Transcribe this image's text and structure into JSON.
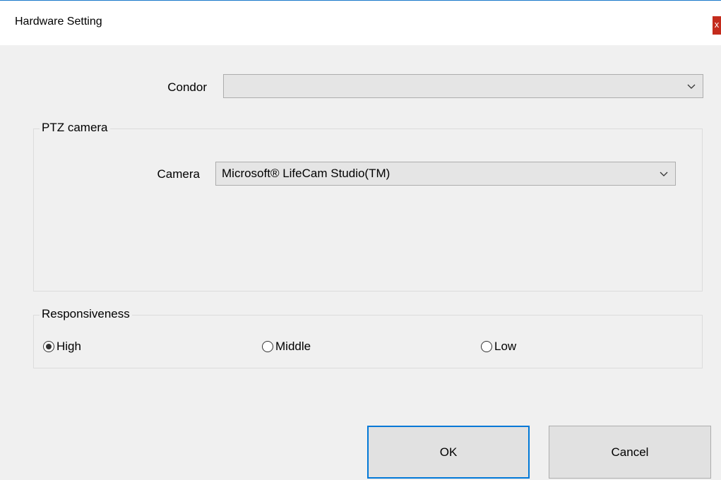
{
  "window": {
    "title": "Hardware Setting",
    "close_label": "x"
  },
  "condor": {
    "label": "Condor",
    "value": ""
  },
  "ptz_group": {
    "legend": "PTZ camera",
    "camera_label": "Camera",
    "camera_value": "Microsoft® LifeCam Studio(TM)"
  },
  "responsiveness": {
    "legend": "Responsiveness",
    "options": [
      {
        "label": "High",
        "checked": true
      },
      {
        "label": "Middle",
        "checked": false
      },
      {
        "label": "Low",
        "checked": false
      }
    ]
  },
  "buttons": {
    "ok_label": "OK",
    "cancel_label": "Cancel"
  },
  "icons": {
    "dropdown": "chevron-down-icon",
    "close": "close-icon"
  }
}
